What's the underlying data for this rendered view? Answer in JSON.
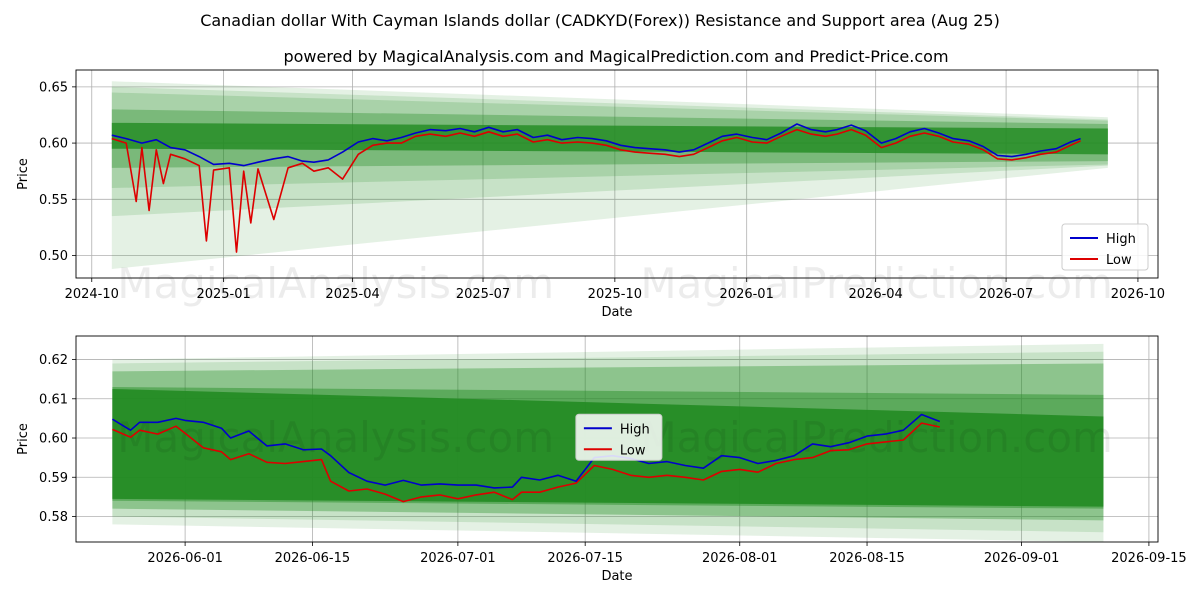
{
  "title": "Canadian dollar With Cayman Islands dollar (CADKYD(Forex)) Resistance and Support area (Aug 25)",
  "subtitle": "powered by MagicalAnalysis.com and MagicalPrediction.com and Predict-Price.com",
  "watermarks": [
    "MagicalAnalysis.com",
    "MagicalPrediction.com"
  ],
  "colors": {
    "high": "#0000cc",
    "low": "#dd0000",
    "band": "#228b22",
    "grid": "#b0b0b0"
  },
  "chart_data": [
    {
      "type": "line",
      "xlabel": "Date",
      "ylabel": "Price",
      "ylim": [
        0.48,
        0.665
      ],
      "xlim": [
        "2024-09-20",
        "2026-10-15"
      ],
      "x_ticks": [
        "2024-10",
        "2025-01",
        "2025-04",
        "2025-07",
        "2025-10",
        "2026-01",
        "2026-04",
        "2026-07",
        "2026-10"
      ],
      "y_ticks": [
        "0.50",
        "0.55",
        "0.60",
        "0.65"
      ],
      "legend": {
        "position": "lower-right",
        "entries": [
          "High",
          "Low"
        ]
      },
      "grid": true,
      "bands": [
        {
          "start": "2024-10-15",
          "end": "2026-09-10",
          "upper": [
            0.655,
            0.623
          ],
          "lower": [
            0.488,
            0.578
          ],
          "opacity": 0.12
        },
        {
          "start": "2024-10-15",
          "end": "2026-09-10",
          "upper": [
            0.65,
            0.621
          ],
          "lower": [
            0.535,
            0.58
          ],
          "opacity": 0.15
        },
        {
          "start": "2024-10-15",
          "end": "2026-09-10",
          "upper": [
            0.645,
            0.62
          ],
          "lower": [
            0.56,
            0.581
          ],
          "opacity": 0.18
        },
        {
          "start": "2024-10-15",
          "end": "2026-09-10",
          "upper": [
            0.63,
            0.617
          ],
          "lower": [
            0.578,
            0.584
          ],
          "opacity": 0.35
        },
        {
          "start": "2024-10-15",
          "end": "2026-09-10",
          "upper": [
            0.618,
            0.613
          ],
          "lower": [
            0.595,
            0.59
          ],
          "opacity": 0.8
        }
      ],
      "series": [
        {
          "name": "High",
          "x": [
            "2024-10-15",
            "2024-10-25",
            "2024-11-05",
            "2024-11-15",
            "2024-11-25",
            "2024-12-05",
            "2024-12-15",
            "2024-12-25",
            "2025-01-05",
            "2025-01-15",
            "2025-01-25",
            "2025-02-05",
            "2025-02-15",
            "2025-02-25",
            "2025-03-05",
            "2025-03-15",
            "2025-03-25",
            "2025-04-05",
            "2025-04-15",
            "2025-04-25",
            "2025-05-05",
            "2025-05-15",
            "2025-05-25",
            "2025-06-05",
            "2025-06-15",
            "2025-06-25",
            "2025-07-05",
            "2025-07-15",
            "2025-07-25",
            "2025-08-05",
            "2025-08-15",
            "2025-08-25",
            "2025-09-05",
            "2025-09-15",
            "2025-09-25",
            "2025-10-05",
            "2025-10-15",
            "2025-10-25",
            "2025-11-05",
            "2025-11-15",
            "2025-11-25",
            "2025-12-05",
            "2025-12-15",
            "2025-12-25",
            "2026-01-05",
            "2026-01-15",
            "2026-01-25",
            "2026-02-05",
            "2026-02-15",
            "2026-02-25",
            "2026-03-05",
            "2026-03-15",
            "2026-03-25",
            "2026-04-05",
            "2026-04-15",
            "2026-04-25",
            "2026-05-05",
            "2026-05-15",
            "2026-05-25",
            "2026-06-05",
            "2026-06-15",
            "2026-06-25",
            "2026-07-05",
            "2026-07-15",
            "2026-07-25",
            "2026-08-05",
            "2026-08-15",
            "2026-08-22"
          ],
          "values": [
            0.607,
            0.604,
            0.6,
            0.603,
            0.596,
            0.594,
            0.588,
            0.581,
            0.582,
            0.58,
            0.583,
            0.586,
            0.588,
            0.584,
            0.583,
            0.585,
            0.592,
            0.601,
            0.604,
            0.602,
            0.605,
            0.609,
            0.612,
            0.611,
            0.613,
            0.61,
            0.614,
            0.61,
            0.612,
            0.605,
            0.607,
            0.603,
            0.605,
            0.604,
            0.602,
            0.598,
            0.596,
            0.595,
            0.594,
            0.592,
            0.594,
            0.6,
            0.606,
            0.608,
            0.605,
            0.603,
            0.609,
            0.617,
            0.612,
            0.61,
            0.612,
            0.616,
            0.611,
            0.6,
            0.604,
            0.61,
            0.613,
            0.609,
            0.604,
            0.602,
            0.597,
            0.589,
            0.588,
            0.59,
            0.593,
            0.595,
            0.601,
            0.604
          ]
        },
        {
          "name": "Low",
          "x": [
            "2024-10-15",
            "2024-10-25",
            "2024-11-01",
            "2024-11-05",
            "2024-11-10",
            "2024-11-15",
            "2024-11-20",
            "2024-11-25",
            "2024-12-05",
            "2024-12-15",
            "2024-12-20",
            "2024-12-25",
            "2025-01-05",
            "2025-01-10",
            "2025-01-15",
            "2025-01-20",
            "2025-01-25",
            "2025-02-05",
            "2025-02-15",
            "2025-02-25",
            "2025-03-05",
            "2025-03-15",
            "2025-03-25",
            "2025-04-05",
            "2025-04-15",
            "2025-04-25",
            "2025-05-05",
            "2025-05-15",
            "2025-05-25",
            "2025-06-05",
            "2025-06-15",
            "2025-06-25",
            "2025-07-05",
            "2025-07-15",
            "2025-07-25",
            "2025-08-05",
            "2025-08-15",
            "2025-08-25",
            "2025-09-05",
            "2025-09-15",
            "2025-09-25",
            "2025-10-05",
            "2025-10-15",
            "2025-10-25",
            "2025-11-05",
            "2025-11-15",
            "2025-11-25",
            "2025-12-05",
            "2025-12-15",
            "2025-12-25",
            "2026-01-05",
            "2026-01-15",
            "2026-01-25",
            "2026-02-05",
            "2026-02-15",
            "2026-02-25",
            "2026-03-05",
            "2026-03-15",
            "2026-03-25",
            "2026-04-05",
            "2026-04-15",
            "2026-04-25",
            "2026-05-05",
            "2026-05-15",
            "2026-05-25",
            "2026-06-05",
            "2026-06-15",
            "2026-06-25",
            "2026-07-05",
            "2026-07-15",
            "2026-07-25",
            "2026-08-05",
            "2026-08-15",
            "2026-08-22"
          ],
          "values": [
            0.604,
            0.6,
            0.548,
            0.596,
            0.54,
            0.594,
            0.564,
            0.59,
            0.586,
            0.58,
            0.513,
            0.576,
            0.578,
            0.503,
            0.575,
            0.529,
            0.577,
            0.532,
            0.578,
            0.582,
            0.575,
            0.578,
            0.568,
            0.59,
            0.598,
            0.6,
            0.6,
            0.606,
            0.608,
            0.606,
            0.609,
            0.606,
            0.61,
            0.606,
            0.608,
            0.601,
            0.603,
            0.6,
            0.601,
            0.6,
            0.598,
            0.594,
            0.592,
            0.591,
            0.59,
            0.588,
            0.59,
            0.596,
            0.602,
            0.605,
            0.601,
            0.6,
            0.606,
            0.612,
            0.608,
            0.606,
            0.608,
            0.612,
            0.607,
            0.596,
            0.6,
            0.606,
            0.609,
            0.606,
            0.601,
            0.599,
            0.594,
            0.586,
            0.585,
            0.587,
            0.59,
            0.592,
            0.598,
            0.602
          ]
        }
      ]
    },
    {
      "type": "line",
      "xlabel": "Date",
      "ylabel": "Price",
      "ylim": [
        0.5735,
        0.626
      ],
      "xlim": [
        "2026-05-20",
        "2026-09-16"
      ],
      "x_ticks": [
        "2026-06-01",
        "2026-06-15",
        "2026-07-01",
        "2026-07-15",
        "2026-08-01",
        "2026-08-15",
        "2026-09-01",
        "2026-09-15"
      ],
      "y_ticks": [
        "0.58",
        "0.59",
        "0.60",
        "0.61",
        "0.62"
      ],
      "legend": {
        "position": "center",
        "entries": [
          "High",
          "Low"
        ]
      },
      "grid": true,
      "bands": [
        {
          "start": "2026-05-24",
          "end": "2026-09-10",
          "upper": [
            0.62,
            0.624
          ],
          "lower": [
            0.578,
            0.5735
          ],
          "opacity": 0.12
        },
        {
          "start": "2026-05-24",
          "end": "2026-09-10",
          "upper": [
            0.619,
            0.622
          ],
          "lower": [
            0.58,
            0.576
          ],
          "opacity": 0.15
        },
        {
          "start": "2026-05-24",
          "end": "2026-09-10",
          "upper": [
            0.617,
            0.619
          ],
          "lower": [
            0.582,
            0.579
          ],
          "opacity": 0.35
        },
        {
          "start": "2026-05-24",
          "end": "2026-09-10",
          "upper": [
            0.613,
            0.611
          ],
          "lower": [
            0.584,
            0.582
          ],
          "opacity": 0.45
        },
        {
          "start": "2026-05-24",
          "end": "2026-09-10",
          "upper": [
            0.6125,
            0.6055
          ],
          "lower": [
            0.5845,
            0.5825
          ],
          "opacity": 0.9
        }
      ],
      "series": [
        {
          "name": "High",
          "x": [
            "2026-05-24",
            "2026-05-26",
            "2026-05-27",
            "2026-05-29",
            "2026-05-31",
            "2026-06-01",
            "2026-06-03",
            "2026-06-05",
            "2026-06-06",
            "2026-06-08",
            "2026-06-10",
            "2026-06-12",
            "2026-06-14",
            "2026-06-16",
            "2026-06-17",
            "2026-06-19",
            "2026-06-21",
            "2026-06-23",
            "2026-06-25",
            "2026-06-27",
            "2026-06-29",
            "2026-07-01",
            "2026-07-03",
            "2026-07-05",
            "2026-07-07",
            "2026-07-08",
            "2026-07-10",
            "2026-07-12",
            "2026-07-14",
            "2026-07-16",
            "2026-07-18",
            "2026-07-20",
            "2026-07-22",
            "2026-07-24",
            "2026-07-26",
            "2026-07-28",
            "2026-07-30",
            "2026-08-01",
            "2026-08-03",
            "2026-08-05",
            "2026-08-07",
            "2026-08-09",
            "2026-08-11",
            "2026-08-13",
            "2026-08-15",
            "2026-08-17",
            "2026-08-19",
            "2026-08-21",
            "2026-08-23"
          ],
          "values": [
            0.6048,
            0.602,
            0.604,
            0.604,
            0.605,
            0.6045,
            0.604,
            0.6025,
            0.6,
            0.6018,
            0.598,
            0.5985,
            0.597,
            0.5972,
            0.5955,
            0.5912,
            0.589,
            0.588,
            0.5892,
            0.588,
            0.5883,
            0.588,
            0.588,
            0.5873,
            0.5875,
            0.59,
            0.5893,
            0.5905,
            0.589,
            0.595,
            0.5955,
            0.5948,
            0.5935,
            0.594,
            0.593,
            0.5923,
            0.5955,
            0.595,
            0.5935,
            0.5943,
            0.5955,
            0.5985,
            0.5978,
            0.5988,
            0.6005,
            0.601,
            0.602,
            0.606,
            0.6042
          ]
        },
        {
          "name": "Low",
          "x": [
            "2026-05-24",
            "2026-05-26",
            "2026-05-27",
            "2026-05-29",
            "2026-05-31",
            "2026-06-01",
            "2026-06-03",
            "2026-06-05",
            "2026-06-06",
            "2026-06-08",
            "2026-06-10",
            "2026-06-12",
            "2026-06-14",
            "2026-06-16",
            "2026-06-17",
            "2026-06-19",
            "2026-06-21",
            "2026-06-23",
            "2026-06-25",
            "2026-06-27",
            "2026-06-29",
            "2026-07-01",
            "2026-07-03",
            "2026-07-05",
            "2026-07-07",
            "2026-07-08",
            "2026-07-10",
            "2026-07-12",
            "2026-07-14",
            "2026-07-16",
            "2026-07-18",
            "2026-07-20",
            "2026-07-22",
            "2026-07-24",
            "2026-07-26",
            "2026-07-28",
            "2026-07-30",
            "2026-08-01",
            "2026-08-03",
            "2026-08-05",
            "2026-08-07",
            "2026-08-09",
            "2026-08-11",
            "2026-08-13",
            "2026-08-15",
            "2026-08-17",
            "2026-08-19",
            "2026-08-21",
            "2026-08-23"
          ],
          "values": [
            0.6022,
            0.6002,
            0.602,
            0.601,
            0.603,
            0.6012,
            0.5975,
            0.5965,
            0.5945,
            0.596,
            0.5938,
            0.5935,
            0.594,
            0.5945,
            0.589,
            0.5865,
            0.587,
            0.5857,
            0.5838,
            0.585,
            0.5855,
            0.5845,
            0.5855,
            0.5862,
            0.5843,
            0.5862,
            0.5862,
            0.5875,
            0.5885,
            0.593,
            0.592,
            0.5905,
            0.59,
            0.5905,
            0.59,
            0.5893,
            0.5915,
            0.592,
            0.5913,
            0.5935,
            0.5945,
            0.595,
            0.5968,
            0.597,
            0.5985,
            0.599,
            0.5995,
            0.6038,
            0.6028
          ]
        }
      ]
    }
  ]
}
